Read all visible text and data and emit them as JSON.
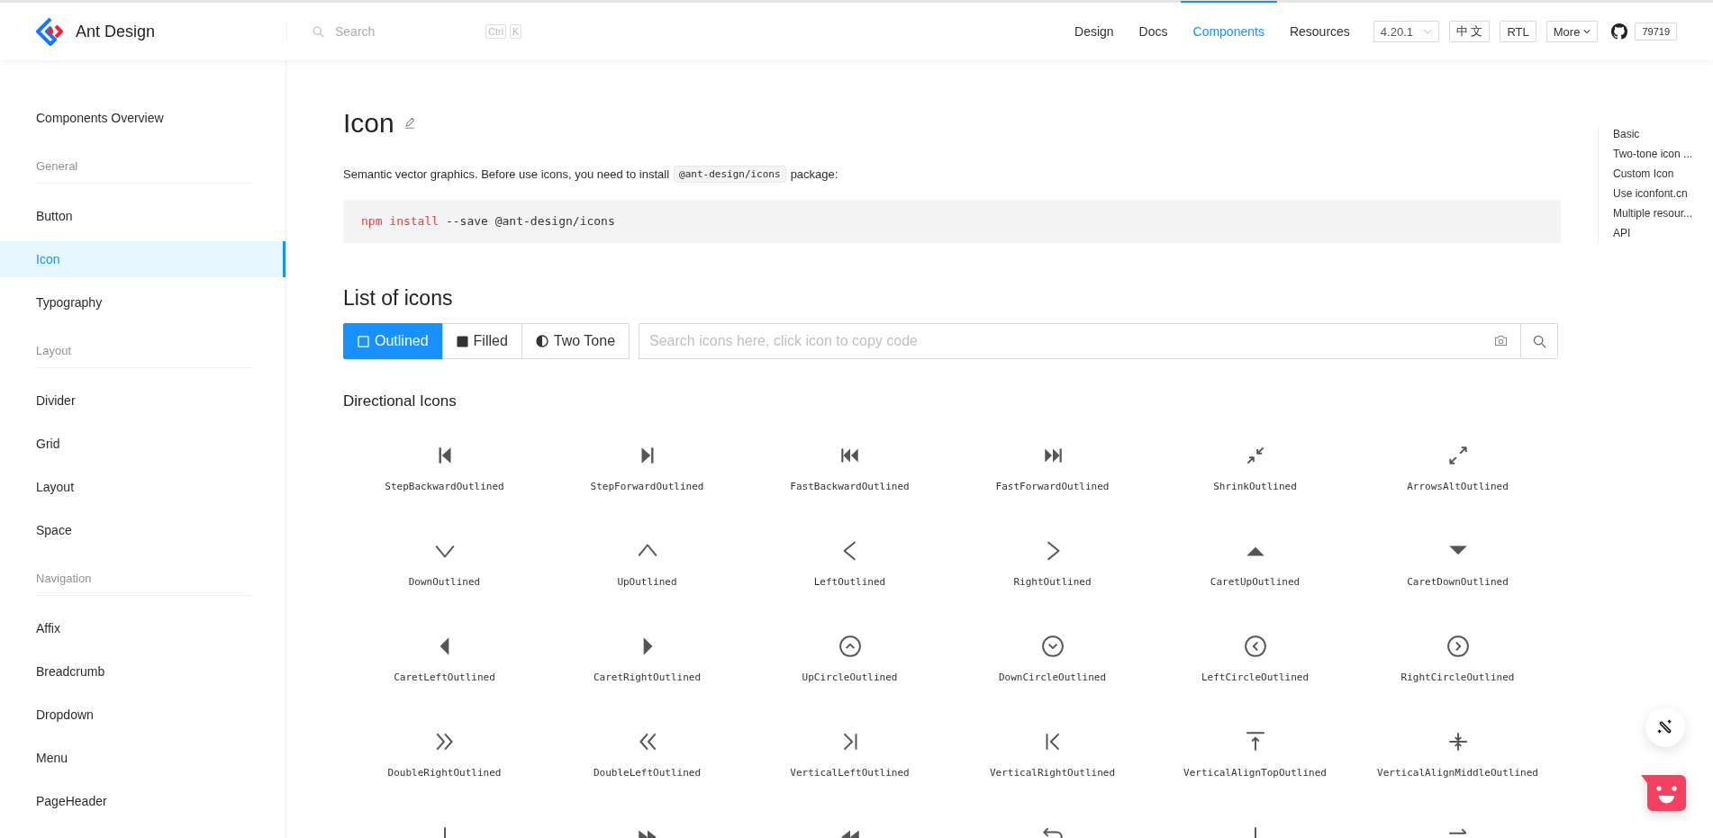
{
  "header": {
    "logo": "Ant Design",
    "search": {
      "placeholder": "Search"
    },
    "keys": [
      "Ctrl",
      "K"
    ],
    "nav": [
      {
        "label": "Design",
        "selected": false
      },
      {
        "label": "Docs",
        "selected": false
      },
      {
        "label": "Components",
        "selected": true
      },
      {
        "label": "Resources",
        "selected": false
      }
    ],
    "version": "4.20.1",
    "language": "中 文",
    "direction": "RTL",
    "more": "More",
    "stars": "79719"
  },
  "sidebar": {
    "items": [
      {
        "kind": "item",
        "label": "Components Overview",
        "selected": false
      },
      {
        "kind": "group",
        "label": "General"
      },
      {
        "kind": "item",
        "label": "Button",
        "selected": false
      },
      {
        "kind": "item",
        "label": "Icon",
        "selected": true
      },
      {
        "kind": "item",
        "label": "Typography",
        "selected": false
      },
      {
        "kind": "group",
        "label": "Layout"
      },
      {
        "kind": "item",
        "label": "Divider",
        "selected": false
      },
      {
        "kind": "item",
        "label": "Grid",
        "selected": false
      },
      {
        "kind": "item",
        "label": "Layout",
        "selected": false
      },
      {
        "kind": "item",
        "label": "Space",
        "selected": false
      },
      {
        "kind": "group",
        "label": "Navigation"
      },
      {
        "kind": "item",
        "label": "Affix",
        "selected": false
      },
      {
        "kind": "item",
        "label": "Breadcrumb",
        "selected": false
      },
      {
        "kind": "item",
        "label": "Dropdown",
        "selected": false
      },
      {
        "kind": "item",
        "label": "Menu",
        "selected": false
      },
      {
        "kind": "item",
        "label": "PageHeader",
        "selected": false
      }
    ]
  },
  "page": {
    "title": "Icon",
    "description": {
      "before": "Semantic vector graphics. Before use icons, you need to install",
      "code": "@ant-design/icons",
      "after": "package:"
    },
    "install": {
      "command": "npm install",
      "args": "--save @ant-design/icons"
    },
    "list_title": "List of icons",
    "themes": [
      {
        "label": "Outlined",
        "selected": true
      },
      {
        "label": "Filled",
        "selected": false
      },
      {
        "label": "Two Tone",
        "selected": false
      }
    ],
    "icon_search": {
      "placeholder": "Search icons here, click icon to copy code"
    },
    "section_title": "Directional Icons",
    "icons": [
      "StepBackwardOutlined",
      "StepForwardOutlined",
      "FastBackwardOutlined",
      "FastForwardOutlined",
      "ShrinkOutlined",
      "ArrowsAltOutlined",
      "DownOutlined",
      "UpOutlined",
      "LeftOutlined",
      "RightOutlined",
      "CaretUpOutlined",
      "CaretDownOutlined",
      "CaretLeftOutlined",
      "CaretRightOutlined",
      "UpCircleOutlined",
      "DownCircleOutlined",
      "LeftCircleOutlined",
      "RightCircleOutlined",
      "DoubleRightOutlined",
      "DoubleLeftOutlined",
      "VerticalLeftOutlined",
      "VerticalRightOutlined",
      "VerticalAlignTopOutlined",
      "VerticalAlignMiddleOutlined"
    ]
  },
  "anchors": [
    "Basic",
    "Two-tone icon ...",
    "Custom Icon",
    "Use iconfont.cn",
    "Multiple resour...",
    "API"
  ]
}
